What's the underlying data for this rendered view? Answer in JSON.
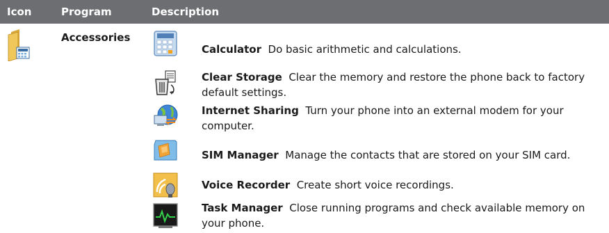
{
  "header": {
    "icon": "Icon",
    "program": "Program",
    "description": "Description"
  },
  "program": {
    "name": "Accessories",
    "icon": "accessories-folder-icon"
  },
  "items": [
    {
      "name": "Calculator",
      "description": "Do basic arithmetic and calculations.",
      "icon": "calculator-icon"
    },
    {
      "name": "Clear Storage",
      "description": "Clear the memory and restore the phone back to factory default settings.",
      "icon": "clear-storage-icon"
    },
    {
      "name": "Internet Sharing",
      "description": "Turn your phone into an external modem for your computer.",
      "icon": "internet-sharing-icon"
    },
    {
      "name": "SIM Manager",
      "description": "Manage the contacts that are stored on your SIM card.",
      "icon": "sim-manager-icon"
    },
    {
      "name": "Voice Recorder",
      "description": "Create short voice recordings.",
      "icon": "voice-recorder-icon"
    },
    {
      "name": "Task Manager",
      "description": "Close running programs and check available memory on your phone.",
      "icon": "task-manager-icon"
    }
  ]
}
